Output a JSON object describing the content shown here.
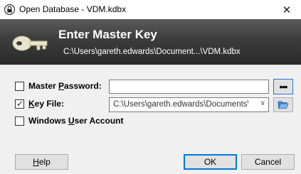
{
  "window": {
    "title": "Open Database - VDM.kdbx",
    "close_glyph": "✕"
  },
  "banner": {
    "title": "Enter Master Key",
    "path": "C:\\Users\\gareth.edwards\\Document...\\VDM.kdbx"
  },
  "form": {
    "master_password": {
      "label_pre": "Master ",
      "label_ul": "P",
      "label_post": "assword:",
      "checked": false,
      "value": "",
      "reveal_label": "•••"
    },
    "key_file": {
      "label_pre": "",
      "label_ul": "K",
      "label_post": "ey File:",
      "checked": true,
      "value": "C:\\Users\\gareth.edwards\\Documents\\vD",
      "dropdown_glyph": "∨"
    },
    "windows_account": {
      "label_pre": "Windows ",
      "label_ul": "U",
      "label_post": "ser Account",
      "checked": false
    }
  },
  "buttons": {
    "help": {
      "ul": "H",
      "rest": "elp"
    },
    "ok": "OK",
    "cancel": "Cancel"
  },
  "colors": {
    "banner_dark": "#2a2a2a",
    "accent": "#0078d7"
  }
}
